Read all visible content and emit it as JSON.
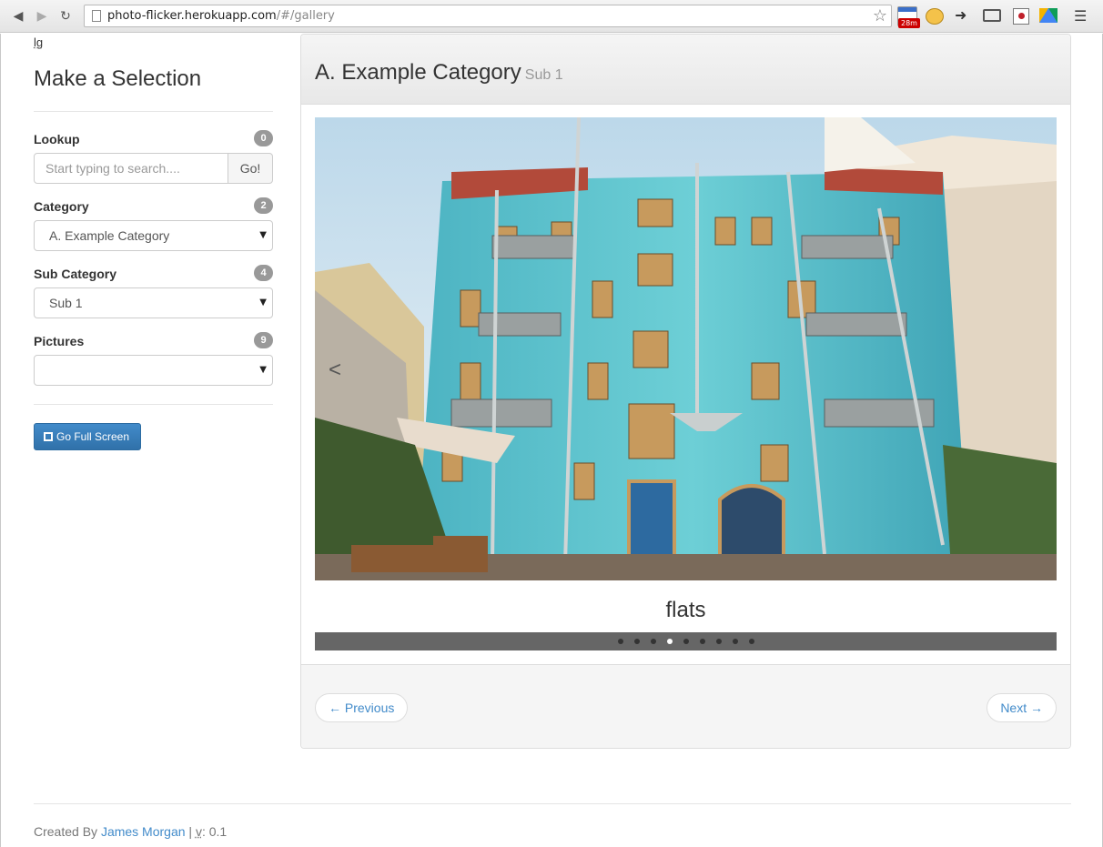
{
  "browser": {
    "url_host": "photo-flicker.herokuapp.com",
    "url_path": "/#/gallery",
    "calendar_badge": "28m"
  },
  "page": {
    "size_label": "lg"
  },
  "sidebar": {
    "title": "Make a Selection",
    "lookup": {
      "label": "Lookup",
      "count": "0",
      "placeholder": "Start typing to search....",
      "button": "Go!"
    },
    "category": {
      "label": "Category",
      "count": "2",
      "selected": "A. Example Category"
    },
    "subcategory": {
      "label": "Sub Category",
      "count": "4",
      "selected": "Sub 1"
    },
    "pictures": {
      "label": "Pictures",
      "count": "9",
      "selected": ""
    },
    "fullscreen_button": "Go Full Screen"
  },
  "gallery": {
    "title": "A. Example Category",
    "subtitle": "Sub 1",
    "prev_arrow": "<",
    "caption": "flats",
    "indicators": {
      "total": 9,
      "active": 4
    },
    "previous_button": "← Previous",
    "next_button": "Next →"
  },
  "footer": {
    "created_by": "Created By",
    "author": "James Morgan",
    "separator": "|",
    "version_label": "v",
    "version": ": 0.1"
  }
}
